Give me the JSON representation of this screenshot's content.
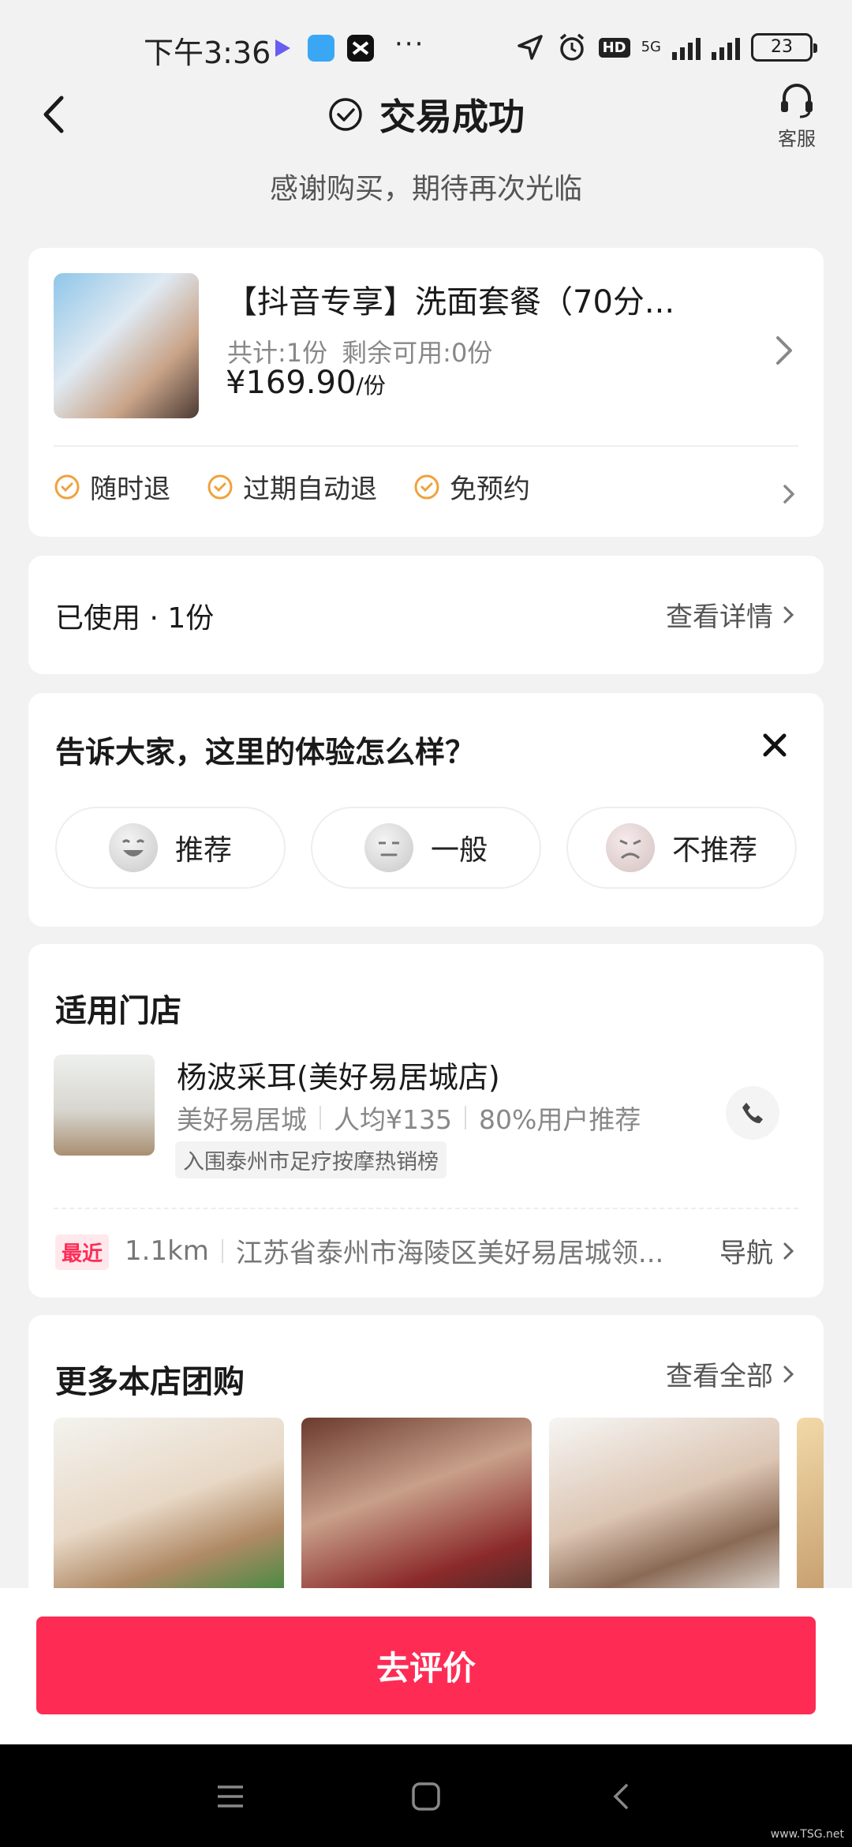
{
  "status_bar": {
    "time": "下午3:36",
    "more": "···",
    "network": "5G",
    "hd": "HD",
    "battery": "23"
  },
  "header": {
    "title": "交易成功",
    "service_label": "客服",
    "subtitle": "感谢购买，期待再次光临"
  },
  "product": {
    "title": "【抖音专享】洗面套餐（70分...",
    "total": "共计:1份",
    "remaining": "剩余可用:0份",
    "price": "¥169.90",
    "price_unit": "/份",
    "tags": [
      "随时退",
      "过期自动退",
      "免预约"
    ]
  },
  "usage": {
    "status": "已使用 · 1份",
    "detail_link": "查看详情"
  },
  "review": {
    "question": "告诉大家，这里的体验怎么样？",
    "options": [
      "推荐",
      "一般",
      "不推荐"
    ]
  },
  "store": {
    "section_title": "适用门店",
    "name": "杨波采耳(美好易居城店)",
    "area": "美好易居城",
    "avg_price": "人均¥135",
    "recommend": "80%用户推荐",
    "rank": "入围泰州市足疗按摩热销榜",
    "nearest_badge": "最近",
    "distance": "1.1km",
    "address": "江苏省泰州市海陵区美好易居城领...",
    "nav_link": "导航"
  },
  "more_deals": {
    "section_title": "更多本店团购",
    "view_all": "查看全部"
  },
  "cta": {
    "label": "去评价"
  },
  "watermark": "www.TSG.net"
}
